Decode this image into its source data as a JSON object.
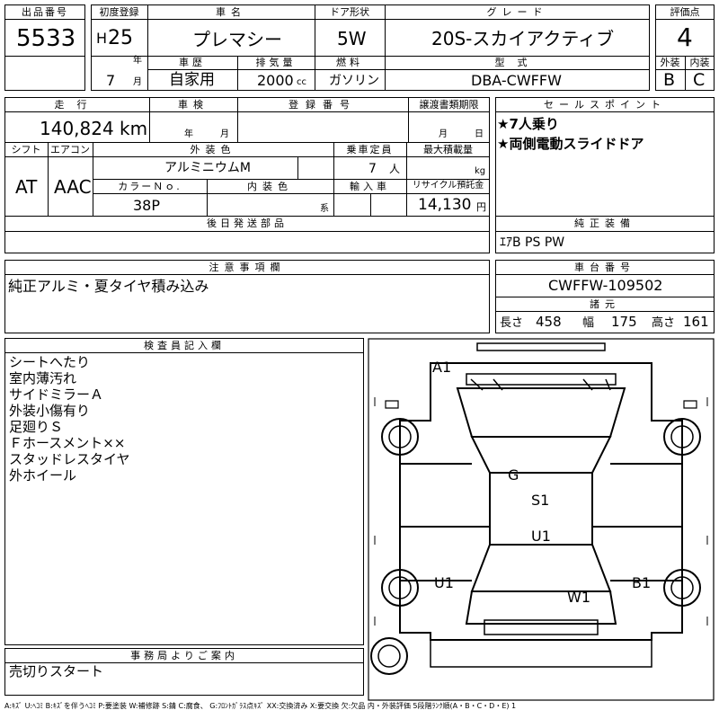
{
  "headers": {
    "lot_no": "出品番号",
    "first_reg": "初度登録",
    "car_name": "車名",
    "door": "ドア形状",
    "grade": "グレード",
    "score": "評価点",
    "history": "車歴",
    "displacement": "排気量",
    "fuel": "燃料",
    "model": "型式",
    "exterior": "外装",
    "interior": "内装",
    "mileage": "走行",
    "inspection": "車検",
    "reg_no": "登録番号",
    "transfer": "譲渡書類期限",
    "sales_point": "セールスポイント",
    "shift": "シフト",
    "aircon": "エアコン",
    "ext_color": "外装色",
    "capacity": "乗車定員",
    "max_load": "最大積載量",
    "color_no": "カラーＮｏ.",
    "int_color": "内装色",
    "import": "輸入車",
    "recycle": "リサイクル預託金",
    "later_parts": "後日発送部品",
    "genuine_equip": "純正装備",
    "notes": "注意事項欄",
    "chassis_no": "車台番号",
    "specs": "諸元",
    "inspector_notes": "検査員記入欄",
    "office_notes": "事務局よりご案内"
  },
  "lot_no": "5533",
  "era": "H",
  "year": "25",
  "year_unit": "年",
  "month": "7",
  "month_unit": "月",
  "car_name": "プレマシー",
  "door": "5W",
  "grade": "20S-スカイアクティブ",
  "score": "4",
  "history": "自家用",
  "displacement": "2000",
  "displacement_unit": "cc",
  "fuel": "ガソリン",
  "model": "DBA-CWFFW",
  "exterior_score": "B",
  "interior_score": "C",
  "mileage": "140,824",
  "mileage_unit": "km",
  "inspection_year_unit": "年",
  "inspection_month_unit": "月",
  "transfer_month_unit": "月",
  "transfer_day_unit": "日",
  "sales_points": [
    "★7人乗り",
    "★両側電動スライドドア"
  ],
  "shift": "AT",
  "aircon": "AAC",
  "ext_color": "アルミニウムM",
  "capacity": "7",
  "capacity_unit": "人",
  "max_load_unit": "kg",
  "color_no": "38P",
  "int_color_unit": "系",
  "recycle": "14,130",
  "recycle_unit": "円",
  "genuine_equip": "ｴｱB PS PW",
  "notes": "純正アルミ・夏タイヤ積み込み",
  "chassis_no": "CWFFW-109502",
  "specs": {
    "length_label": "長さ",
    "length": "458",
    "width_label": "幅",
    "width": "175",
    "height_label": "高さ",
    "height": "161"
  },
  "inspector_notes": [
    "シートへたり",
    "室内薄汚れ",
    "サイドミラーＡ",
    "外装小傷有り",
    "足廻りＳ",
    "Ｆホースメント××",
    "スタッドレスタイヤ",
    "外ホイール"
  ],
  "office_notes": "売切りスタート",
  "diagram_marks": {
    "a1": "A1",
    "g": "G",
    "s1": "S1",
    "u1_center": "U1",
    "u1_left": "U1",
    "b1": "B1",
    "w1": "W1"
  },
  "legend": "A:ｷｽﾞ U:ﾍｺﾐ B:ｷｽﾞを伴うﾍｺﾐ P:要塗装 W:補修跡 S:錆 C:腐食、 G:ﾌﾛﾝﾄｶﾞﾗｽ点ｷｽﾞ XX:交換済み X:要交換 欠:欠品 内・外装評価 5段階ﾗﾝｸ順(A・B・C・D・E) 1"
}
